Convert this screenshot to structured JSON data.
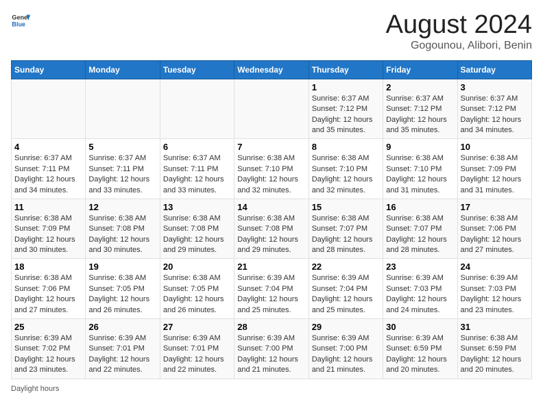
{
  "header": {
    "logo_general": "General",
    "logo_blue": "Blue",
    "main_title": "August 2024",
    "subtitle": "Gogounou, Alibori, Benin"
  },
  "days_of_week": [
    "Sunday",
    "Monday",
    "Tuesday",
    "Wednesday",
    "Thursday",
    "Friday",
    "Saturday"
  ],
  "weeks": [
    [
      {
        "num": "",
        "info": ""
      },
      {
        "num": "",
        "info": ""
      },
      {
        "num": "",
        "info": ""
      },
      {
        "num": "",
        "info": ""
      },
      {
        "num": "1",
        "info": "Sunrise: 6:37 AM\nSunset: 7:12 PM\nDaylight: 12 hours\nand 35 minutes."
      },
      {
        "num": "2",
        "info": "Sunrise: 6:37 AM\nSunset: 7:12 PM\nDaylight: 12 hours\nand 35 minutes."
      },
      {
        "num": "3",
        "info": "Sunrise: 6:37 AM\nSunset: 7:12 PM\nDaylight: 12 hours\nand 34 minutes."
      }
    ],
    [
      {
        "num": "4",
        "info": "Sunrise: 6:37 AM\nSunset: 7:11 PM\nDaylight: 12 hours\nand 34 minutes."
      },
      {
        "num": "5",
        "info": "Sunrise: 6:37 AM\nSunset: 7:11 PM\nDaylight: 12 hours\nand 33 minutes."
      },
      {
        "num": "6",
        "info": "Sunrise: 6:37 AM\nSunset: 7:11 PM\nDaylight: 12 hours\nand 33 minutes."
      },
      {
        "num": "7",
        "info": "Sunrise: 6:38 AM\nSunset: 7:10 PM\nDaylight: 12 hours\nand 32 minutes."
      },
      {
        "num": "8",
        "info": "Sunrise: 6:38 AM\nSunset: 7:10 PM\nDaylight: 12 hours\nand 32 minutes."
      },
      {
        "num": "9",
        "info": "Sunrise: 6:38 AM\nSunset: 7:10 PM\nDaylight: 12 hours\nand 31 minutes."
      },
      {
        "num": "10",
        "info": "Sunrise: 6:38 AM\nSunset: 7:09 PM\nDaylight: 12 hours\nand 31 minutes."
      }
    ],
    [
      {
        "num": "11",
        "info": "Sunrise: 6:38 AM\nSunset: 7:09 PM\nDaylight: 12 hours\nand 30 minutes."
      },
      {
        "num": "12",
        "info": "Sunrise: 6:38 AM\nSunset: 7:08 PM\nDaylight: 12 hours\nand 30 minutes."
      },
      {
        "num": "13",
        "info": "Sunrise: 6:38 AM\nSunset: 7:08 PM\nDaylight: 12 hours\nand 29 minutes."
      },
      {
        "num": "14",
        "info": "Sunrise: 6:38 AM\nSunset: 7:08 PM\nDaylight: 12 hours\nand 29 minutes."
      },
      {
        "num": "15",
        "info": "Sunrise: 6:38 AM\nSunset: 7:07 PM\nDaylight: 12 hours\nand 28 minutes."
      },
      {
        "num": "16",
        "info": "Sunrise: 6:38 AM\nSunset: 7:07 PM\nDaylight: 12 hours\nand 28 minutes."
      },
      {
        "num": "17",
        "info": "Sunrise: 6:38 AM\nSunset: 7:06 PM\nDaylight: 12 hours\nand 27 minutes."
      }
    ],
    [
      {
        "num": "18",
        "info": "Sunrise: 6:38 AM\nSunset: 7:06 PM\nDaylight: 12 hours\nand 27 minutes."
      },
      {
        "num": "19",
        "info": "Sunrise: 6:38 AM\nSunset: 7:05 PM\nDaylight: 12 hours\nand 26 minutes."
      },
      {
        "num": "20",
        "info": "Sunrise: 6:38 AM\nSunset: 7:05 PM\nDaylight: 12 hours\nand 26 minutes."
      },
      {
        "num": "21",
        "info": "Sunrise: 6:39 AM\nSunset: 7:04 PM\nDaylight: 12 hours\nand 25 minutes."
      },
      {
        "num": "22",
        "info": "Sunrise: 6:39 AM\nSunset: 7:04 PM\nDaylight: 12 hours\nand 25 minutes."
      },
      {
        "num": "23",
        "info": "Sunrise: 6:39 AM\nSunset: 7:03 PM\nDaylight: 12 hours\nand 24 minutes."
      },
      {
        "num": "24",
        "info": "Sunrise: 6:39 AM\nSunset: 7:03 PM\nDaylight: 12 hours\nand 23 minutes."
      }
    ],
    [
      {
        "num": "25",
        "info": "Sunrise: 6:39 AM\nSunset: 7:02 PM\nDaylight: 12 hours\nand 23 minutes."
      },
      {
        "num": "26",
        "info": "Sunrise: 6:39 AM\nSunset: 7:01 PM\nDaylight: 12 hours\nand 22 minutes."
      },
      {
        "num": "27",
        "info": "Sunrise: 6:39 AM\nSunset: 7:01 PM\nDaylight: 12 hours\nand 22 minutes."
      },
      {
        "num": "28",
        "info": "Sunrise: 6:39 AM\nSunset: 7:00 PM\nDaylight: 12 hours\nand 21 minutes."
      },
      {
        "num": "29",
        "info": "Sunrise: 6:39 AM\nSunset: 7:00 PM\nDaylight: 12 hours\nand 21 minutes."
      },
      {
        "num": "30",
        "info": "Sunrise: 6:39 AM\nSunset: 6:59 PM\nDaylight: 12 hours\nand 20 minutes."
      },
      {
        "num": "31",
        "info": "Sunrise: 6:38 AM\nSunset: 6:59 PM\nDaylight: 12 hours\nand 20 minutes."
      }
    ]
  ],
  "footer": {
    "daylight_label": "Daylight hours"
  }
}
